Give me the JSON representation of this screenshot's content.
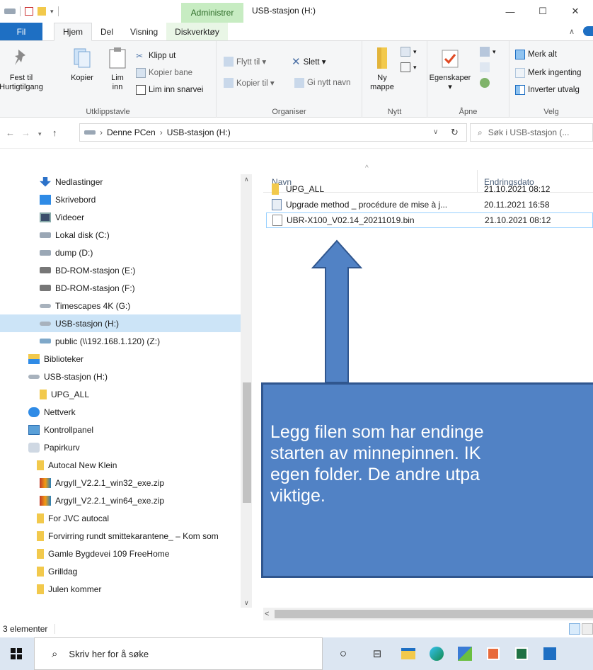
{
  "window": {
    "title": "USB-stasjon (H:)",
    "context_tab": "Administrer",
    "minimize": "—",
    "maximize": "☐",
    "close": "✕"
  },
  "ribbon_tabs": [
    "Fil",
    "Hjem",
    "Del",
    "Visning",
    "Diskverktøy"
  ],
  "ribbon": {
    "clipboard": {
      "label": "Utklippstavle",
      "pin": "Fest til\nHurtigtilgang",
      "copy": "Kopier",
      "paste": "Lim\ninn",
      "cut": "Klipp ut",
      "copy_path": "Kopier bane",
      "paste_shortcut": "Lim inn snarvei"
    },
    "organize": {
      "label": "Organiser",
      "move_to": "Flytt til ▾",
      "copy_to": "Kopier til ▾",
      "delete": "Slett ▾",
      "rename": "Gi nytt navn"
    },
    "new": {
      "label": "Nytt",
      "new_folder": "Ny\nmappe"
    },
    "open": {
      "label": "Åpne",
      "properties": "Egenskaper\n▾"
    },
    "select": {
      "label": "Velg",
      "select_all": "Merk alt",
      "select_none": "Merk ingenting",
      "invert": "Inverter utvalg"
    }
  },
  "address": {
    "crumbs": [
      "Denne PCen",
      "USB-stasjon (H:)"
    ],
    "separator": "›",
    "search_placeholder": "Søk i USB-stasjon (..."
  },
  "nav_items": [
    {
      "label": "Nedlastinger",
      "icon": "download-icon"
    },
    {
      "label": "Skrivebord",
      "icon": "desktop-icon"
    },
    {
      "label": "Videoer",
      "icon": "videos-icon"
    },
    {
      "label": "Lokal disk (C:)",
      "icon": "drive-icon"
    },
    {
      "label": "dump (D:)",
      "icon": "drive-icon"
    },
    {
      "label": "BD-ROM-stasjon (E:)",
      "icon": "optical-drive-icon"
    },
    {
      "label": "BD-ROM-stasjon (F:)",
      "icon": "optical-drive-icon"
    },
    {
      "label": "Timescapes 4K (G:)",
      "icon": "usb-drive-icon"
    },
    {
      "label": "USB-stasjon (H:)",
      "icon": "usb-drive-icon",
      "selected": true
    },
    {
      "label": "public (\\\\192.168.1.120) (Z:)",
      "icon": "network-drive-icon"
    },
    {
      "label": "Biblioteker",
      "icon": "libraries-icon"
    },
    {
      "label": "USB-stasjon (H:)",
      "icon": "usb-drive-icon"
    },
    {
      "label": "UPG_ALL",
      "icon": "folder-icon"
    },
    {
      "label": "Nettverk",
      "icon": "network-icon"
    },
    {
      "label": "Kontrollpanel",
      "icon": "control-panel-icon"
    },
    {
      "label": "Papirkurv",
      "icon": "recycle-bin-icon"
    },
    {
      "label": "Autocal New Klein",
      "icon": "folder-icon"
    },
    {
      "label": "Argyll_V2.2.1_win32_exe.zip",
      "icon": "zip-icon"
    },
    {
      "label": "Argyll_V2.2.1_win64_exe.zip",
      "icon": "zip-icon"
    },
    {
      "label": "For JVC autocal",
      "icon": "folder-icon"
    },
    {
      "label": "Forvirring rundt smittekarantene_ – Kom som",
      "icon": "folder-icon"
    },
    {
      "label": "Gamle Bygdevei 109 FreeHome",
      "icon": "folder-icon"
    },
    {
      "label": "Grilldag",
      "icon": "folder-icon"
    },
    {
      "label": "Julen kommer",
      "icon": "folder-icon"
    }
  ],
  "columns": {
    "name": "Navn",
    "date": "Endringsdato"
  },
  "files": [
    {
      "name": "UPG_ALL",
      "date": "21.10.2021 08:12",
      "icon": "folder-icon"
    },
    {
      "name": "Upgrade method _ procédure de mise à j...",
      "date": "20.11.2021 16:58",
      "icon": "document-icon"
    },
    {
      "name": "UBR-X100_V02.14_20211019.bin",
      "date": "21.10.2021 08:12",
      "icon": "file-icon",
      "highlighted": true
    }
  ],
  "status": {
    "count": "3 elementer"
  },
  "callout": {
    "text": "Legg filen som har endinge\nstarten av minnepinnen. IK\negen folder. De andre utpa\nviktige."
  },
  "taskbar": {
    "search_placeholder": "Skriv her for å søke"
  },
  "colors": {
    "accent": "#1e6fc3",
    "context_tab_bg": "#c7ecc2",
    "selection": "#cce4f7",
    "callout_fill": "#5182c5",
    "callout_border": "#30568e"
  }
}
